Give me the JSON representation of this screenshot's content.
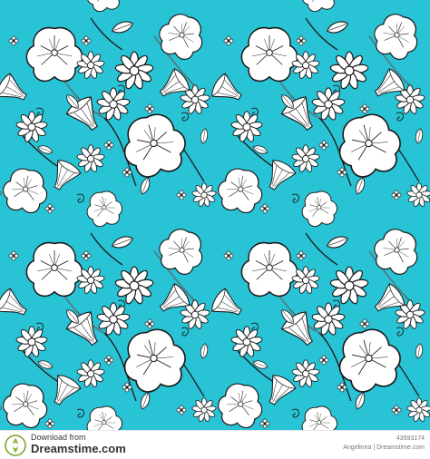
{
  "image": {
    "kind": "seamless floral pattern",
    "background_color": "#29c3d6",
    "flower_fill": "#ffffff",
    "outline_color": "#1a1a1a"
  },
  "footer": {
    "download_label": "Download from",
    "brand": "Dreamstime.com",
    "image_id": "43593174",
    "credit": "Angelinna | Dreamstime.com",
    "logo_icon": "dreamstime-logo-icon"
  }
}
